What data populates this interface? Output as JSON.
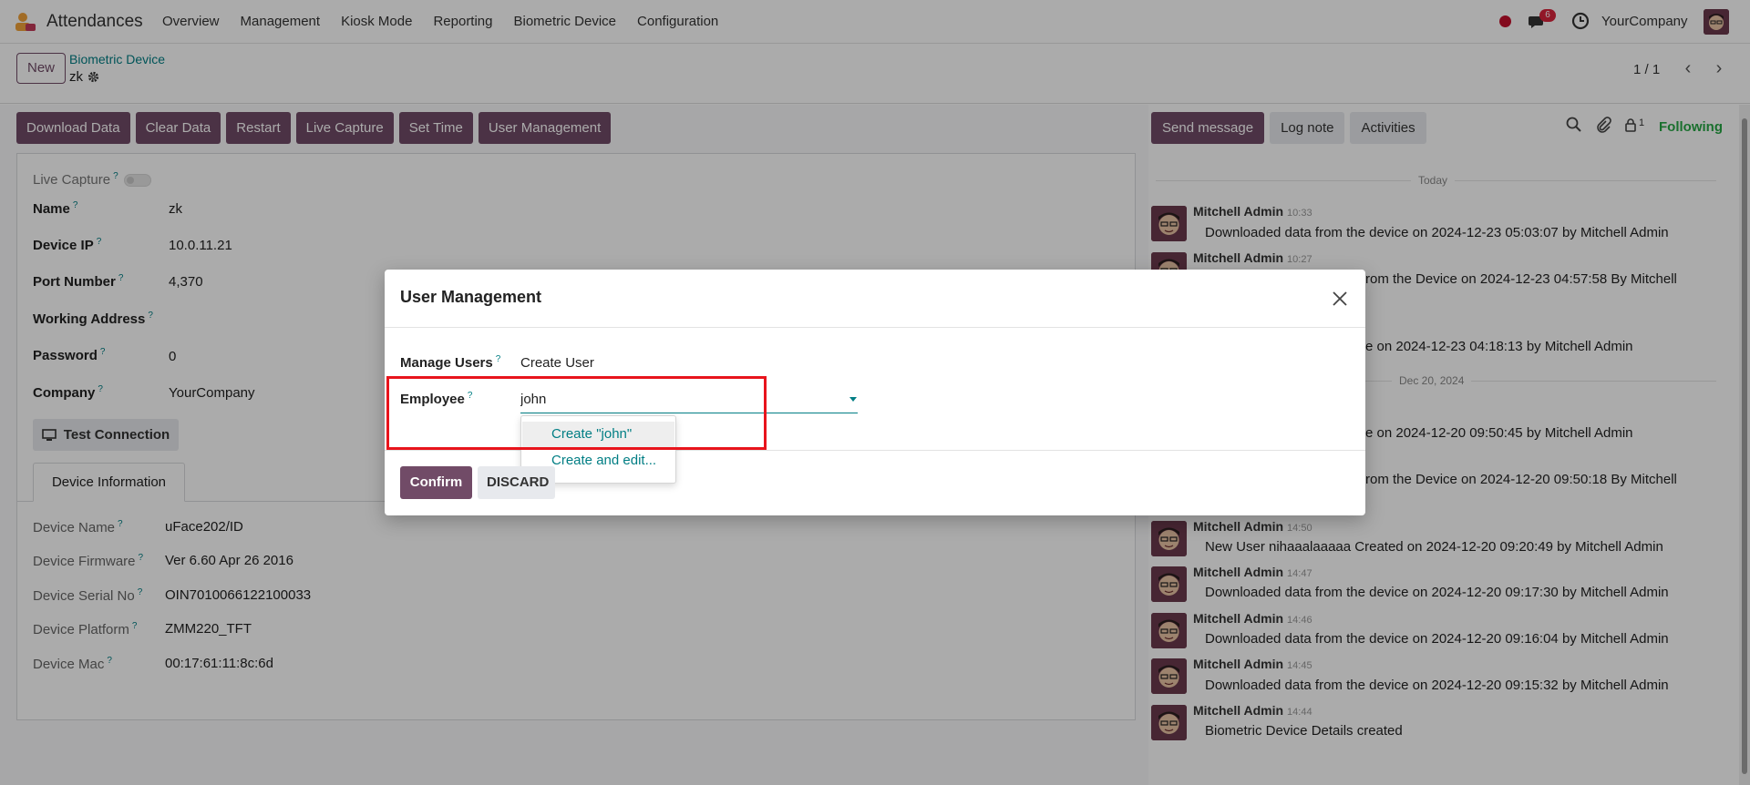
{
  "navbar": {
    "app_name": "Attendances",
    "menu": [
      "Overview",
      "Management",
      "Kiosk Mode",
      "Reporting",
      "Biometric Device",
      "Configuration"
    ],
    "chat_badge": "6",
    "company": "YourCompany"
  },
  "control_panel": {
    "new_label": "New",
    "breadcrumb_parent": "Biometric Device",
    "breadcrumb_current": "zk",
    "pager": "1 / 1"
  },
  "statusbar": {
    "buttons": [
      "Download Data",
      "Clear Data",
      "Restart",
      "Live Capture",
      "Set Time",
      "User Management"
    ]
  },
  "form": {
    "live_capture_label": "Live Capture",
    "name_label": "Name",
    "name_value": "zk",
    "device_ip_label": "Device IP",
    "device_ip_value": "10.0.11.21",
    "port_label": "Port Number",
    "port_value": "4,370",
    "working_address_label": "Working Address",
    "password_label": "Password",
    "password_value": "0",
    "company_label": "Company",
    "company_value": "YourCompany",
    "test_connection_label": "Test Connection",
    "tab_label": "Device Information",
    "info": [
      {
        "label": "Device Name",
        "value": "uFace202/ID"
      },
      {
        "label": "Device Firmware",
        "value": "Ver 6.60 Apr 26 2016"
      },
      {
        "label": "Device Serial No",
        "value": "OIN7010066122100033"
      },
      {
        "label": "Device Platform",
        "value": "ZMM220_TFT"
      },
      {
        "label": "Device Mac",
        "value": "00:17:61:11:8c:6d"
      }
    ]
  },
  "chatter": {
    "send_message": "Send message",
    "log_note": "Log note",
    "activities": "Activities",
    "followers_count": "1",
    "following": "Following",
    "sep_today": "Today",
    "sep_dec20": "Dec 20, 2024",
    "messages": [
      {
        "author": "Mitchell Admin",
        "time": "10:33",
        "body": "Downloaded data from the device on 2024-12-23 05:03:07 by Mitchell Admin"
      },
      {
        "author": "Mitchell Admin",
        "time": "10:27",
        "body": "rom the Device on 2024-12-23 04:57:58 By Mitchell"
      },
      {
        "author": "",
        "time": "",
        "body": "e on 2024-12-23 04:18:13 by Mitchell Admin"
      },
      {
        "author": "",
        "time": "",
        "body": "e on 2024-12-20 09:50:45 by Mitchell Admin"
      },
      {
        "author": "",
        "time": "",
        "body": "rom the Device on 2024-12-20 09:50:18 By Mitchell"
      },
      {
        "author": "Mitchell Admin",
        "time": "14:50",
        "body": "New User nihaaalaaaaa Created on 2024-12-20 09:20:49 by Mitchell Admin"
      },
      {
        "author": "Mitchell Admin",
        "time": "14:47",
        "body": "Downloaded data from the device on 2024-12-20 09:17:30 by Mitchell Admin"
      },
      {
        "author": "Mitchell Admin",
        "time": "14:46",
        "body": "Downloaded data from the device on 2024-12-20 09:16:04 by Mitchell Admin"
      },
      {
        "author": "Mitchell Admin",
        "time": "14:45",
        "body": "Downloaded data from the device on 2024-12-20 09:15:32 by Mitchell Admin"
      },
      {
        "author": "Mitchell Admin",
        "time": "14:44",
        "body": "Biometric Device Details created"
      }
    ]
  },
  "modal": {
    "title": "User Management",
    "manage_users_label": "Manage Users",
    "manage_users_value": "Create User",
    "employee_label": "Employee",
    "employee_input_value": "john",
    "dropdown": [
      "Create \"john\"",
      "Create and edit..."
    ],
    "confirm_label": "Confirm",
    "discard_label": "DISCARD"
  },
  "colors": {
    "primary": "#714B67",
    "link": "#017e84",
    "highlight": "#e8141c",
    "following": "#28a745"
  }
}
